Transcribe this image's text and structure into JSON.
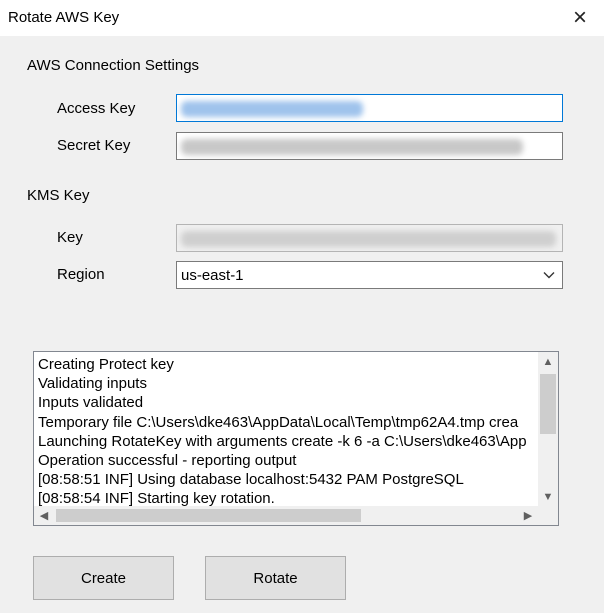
{
  "window": {
    "title": "Rotate AWS Key",
    "close_icon": "×"
  },
  "aws": {
    "group_label": "AWS Connection Settings",
    "access_key_label": "Access Key",
    "secret_key_label": "Secret Key"
  },
  "kms": {
    "group_label": "KMS Key",
    "key_label": "Key",
    "region_label": "Region",
    "region_value": "us-east-1"
  },
  "log": {
    "lines": [
      "Creating Protect key",
      "Validating inputs",
      "Inputs validated",
      "Temporary file C:\\Users\\dke463\\AppData\\Local\\Temp\\tmp62A4.tmp crea",
      "Launching RotateKey with arguments create -k 6 -a C:\\Users\\dke463\\App",
      "Operation successful - reporting output",
      "[08:58:51 INF] Using database localhost:5432 PAM PostgreSQL",
      "[08:58:54 INF] Starting key rotation."
    ]
  },
  "buttons": {
    "create": "Create",
    "rotate": "Rotate"
  }
}
